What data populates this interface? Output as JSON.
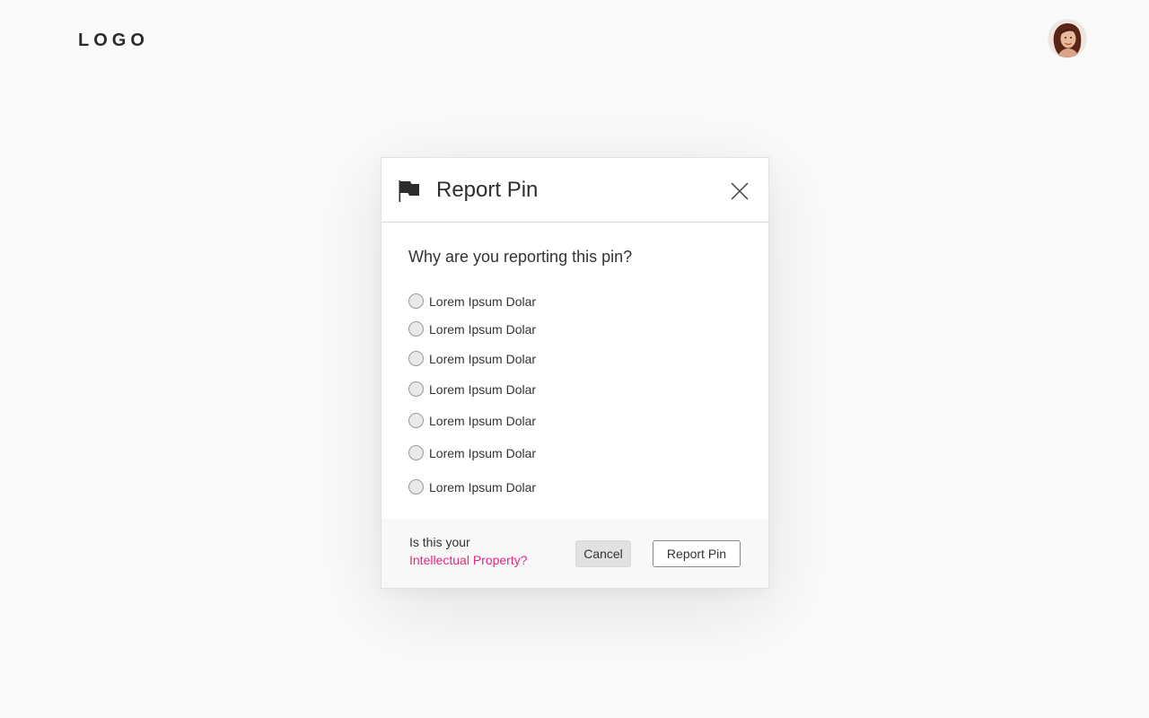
{
  "header": {
    "logo_text": "LOGO",
    "avatar_icon": "user-avatar-photo"
  },
  "modal": {
    "title": "Report Pin",
    "title_icon": "flag-icon",
    "close_icon": "close-icon",
    "question": "Why are you reporting this pin?",
    "options": [
      {
        "label": "Lorem Ipsum Dolar",
        "selected": false
      },
      {
        "label": "Lorem Ipsum Dolar",
        "selected": false
      },
      {
        "label": "Lorem Ipsum Dolar",
        "selected": false
      },
      {
        "label": "Lorem Ipsum Dolar",
        "selected": false
      },
      {
        "label": "Lorem Ipsum Dolar",
        "selected": false
      },
      {
        "label": "Lorem Ipsum Dolar",
        "selected": false
      },
      {
        "label": "Lorem Ipsum Dolar",
        "selected": false
      }
    ],
    "footer": {
      "ip_question": "Is this your",
      "ip_link": "Intellectual Property?",
      "cancel_label": "Cancel",
      "report_label": "Report Pin"
    }
  },
  "colors": {
    "background": "#fafafa",
    "link_accent": "#e6287e",
    "cancel_bg": "#e1e1e1"
  }
}
